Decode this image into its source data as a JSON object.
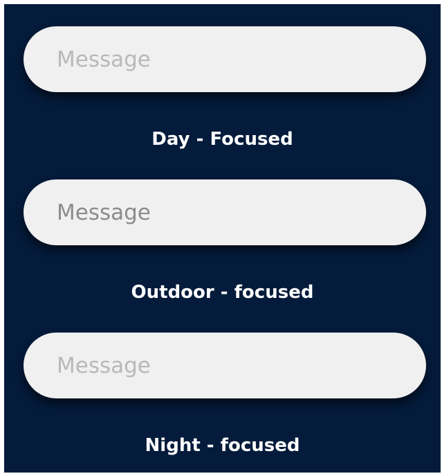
{
  "fields": [
    {
      "placeholder": "Message",
      "value": "",
      "caption": "Day - Focused"
    },
    {
      "placeholder": "Message",
      "value": "",
      "caption": "Outdoor - focused"
    },
    {
      "placeholder": "Message",
      "value": "",
      "caption": "Night - focused"
    }
  ],
  "colors": {
    "background": "#041b3b",
    "field": "#f0f0f0",
    "placeholder_day": "#b9b9b9",
    "placeholder_outdoor": "#8c8c8c",
    "placeholder_night": "#b9b9b9",
    "caption_text": "#ffffff"
  }
}
